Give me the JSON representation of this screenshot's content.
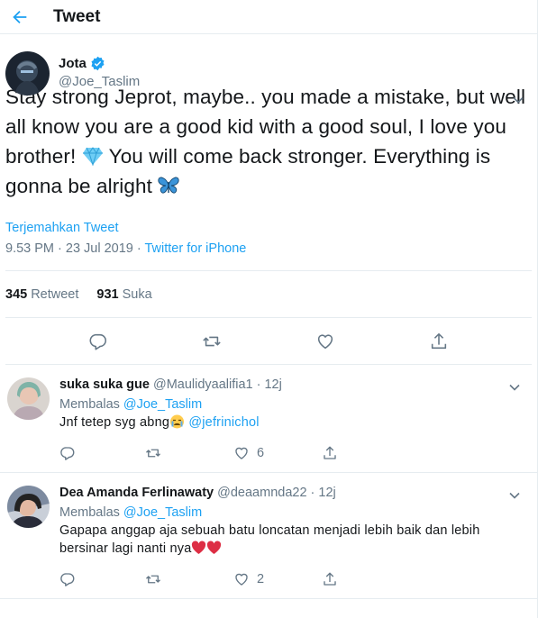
{
  "header": {
    "title": "Tweet"
  },
  "colors": {
    "accent": "#1da1f2",
    "muted": "#657786",
    "text": "#14171a",
    "divider": "#e6ecf0",
    "heart": "#e0245e"
  },
  "tweet": {
    "author_name": "Jota",
    "author_handle": "@Joe_Taslim",
    "text_part1": "Stay strong Jeprot, maybe.. you made a mistake, but well all know you are a good kid with a good soul, I love you brother! ",
    "emoji1": "gem-emoji",
    "text_part2": " You will come back stronger. Everything is gonna be alright ",
    "emoji2": "butterfly-emoji",
    "translate_label": "Terjemahkan Tweet",
    "timestamp": "9.53 PM · 23 Jul 2019 · ",
    "source": "Twitter for iPhone",
    "retweet_count": "345",
    "retweet_label": "Retweet",
    "like_count": "931",
    "like_label": "Suka"
  },
  "replies": [
    {
      "name": "suka suka gue",
      "handle_time": "@Maulidyaalifia1 · 12j",
      "replying_prefix": "Membalas ",
      "replying_to": "@Joe_Taslim",
      "text": "Jnf tetep syg abng",
      "emoji": "crying-face-emoji",
      "mention": " @jefrinichol",
      "like_count": "6"
    },
    {
      "name": "Dea Amanda Ferlinawaty",
      "handle_time": "@deaamnda22 · 12j",
      "replying_prefix": "Membalas ",
      "replying_to": "@Joe_Taslim",
      "text": "Gapapa anggap aja sebuah batu loncatan menjadi lebih baik dan lebih bersinar lagi nanti nya",
      "emoji": "red-heart-emoji",
      "like_count": "2"
    }
  ]
}
